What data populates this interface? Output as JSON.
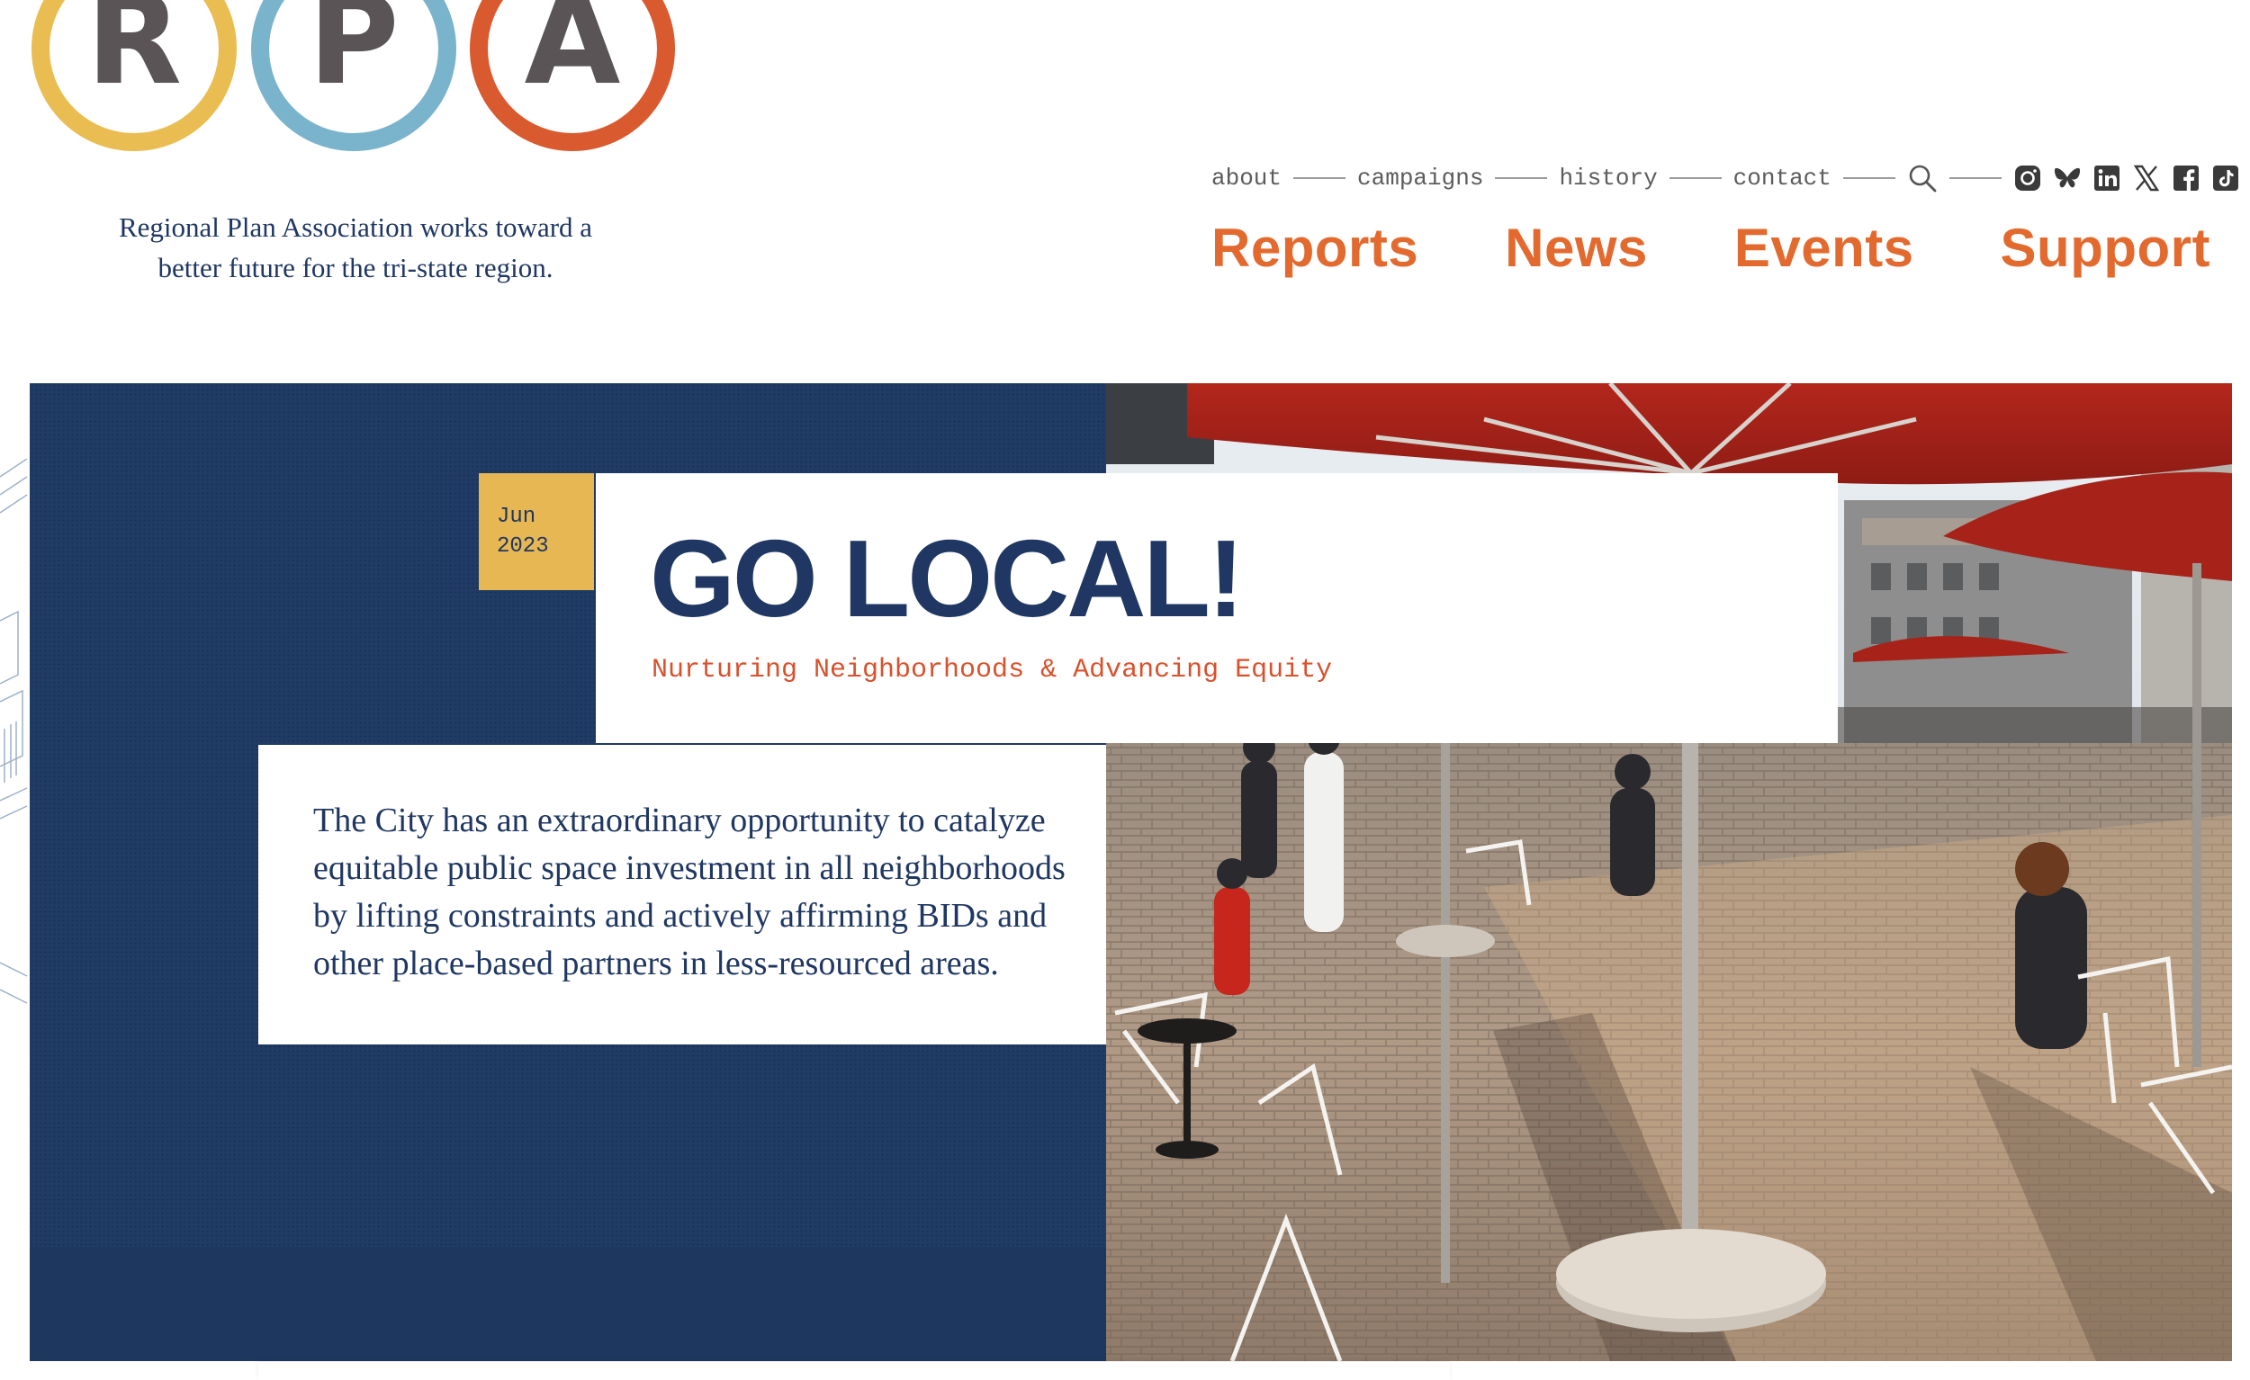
{
  "logo": {
    "letters": [
      "R",
      "P",
      "A"
    ],
    "ring_colors": [
      "#e9bd52",
      "#7ab4cc",
      "#da5a2f"
    ],
    "tagline_line1": "Regional Plan Association works toward a",
    "tagline_line2": "better future for the tri-state region."
  },
  "utility_nav": {
    "items": [
      "about",
      "campaigns",
      "history",
      "contact"
    ],
    "search_icon": "search-icon",
    "social_icons": [
      "instagram-icon",
      "bluesky-icon",
      "linkedin-icon",
      "x-icon",
      "facebook-icon",
      "tiktok-icon"
    ]
  },
  "main_nav": {
    "items": [
      "Reports",
      "News",
      "Events",
      "Support"
    ],
    "color": "#e36a2f"
  },
  "hero": {
    "date_month": "Jun",
    "date_year": "2023",
    "title": "GO LOCAL!",
    "subtitle": "Nurturing Neighborhoods & Advancing Equity",
    "body": "The City has an extraordinary opportunity to catalyze equitable public space investment in all neighborhoods by lifting constraints and actively affirming BIDs and other place-based partners in less-resourced areas.",
    "colors": {
      "navy": "#1f3762",
      "gold": "#e6b753",
      "orange": "#d9512c"
    }
  }
}
